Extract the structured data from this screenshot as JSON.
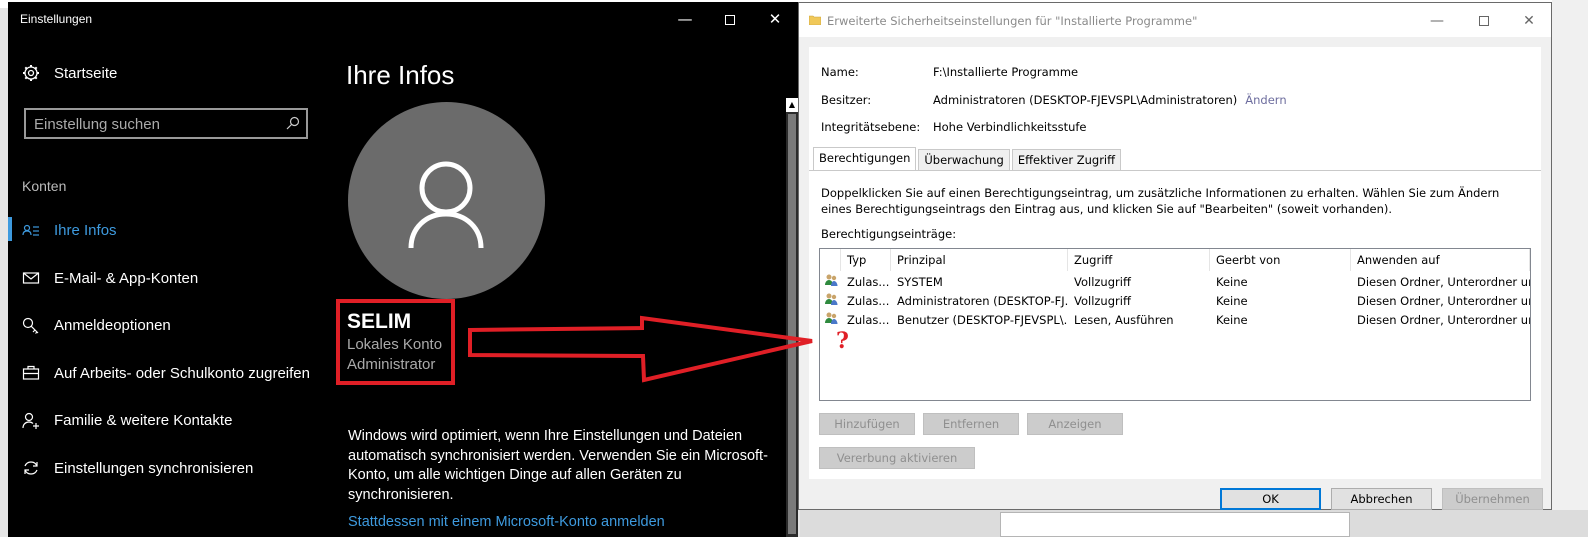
{
  "settings": {
    "window_title": "Einstellungen",
    "controls": {
      "minimize": "—",
      "close": "✕"
    },
    "home_label": "Startseite",
    "search": {
      "placeholder": "Einstellung suchen",
      "value": ""
    },
    "section_label": "Konten",
    "nav": [
      {
        "label": "Ihre Infos",
        "icon": "person-card-icon",
        "active": true
      },
      {
        "label": "E-Mail- & App-Konten",
        "icon": "mail-icon",
        "active": false
      },
      {
        "label": "Anmeldeoptionen",
        "icon": "key-icon",
        "active": false
      },
      {
        "label": "Auf Arbeits- oder Schulkonto zugreifen",
        "icon": "briefcase-icon",
        "active": false
      },
      {
        "label": "Familie & weitere Kontakte",
        "icon": "person-add-icon",
        "active": false
      },
      {
        "label": "Einstellungen synchronisieren",
        "icon": "sync-icon",
        "active": false
      }
    ],
    "heading": "Ihre Infos",
    "user": {
      "name": "SELIM",
      "account_type": "Lokales Konto",
      "role": "Administrator"
    },
    "description": "Windows wird optimiert, wenn Ihre Einstellungen und Dateien automatisch synchronisiert werden. Verwenden Sie ein Microsoft-Konto, um alle wichtigen Dinge auf allen Geräten zu synchronisieren.",
    "link": "Stattdessen mit einem Microsoft-Konto anmelden",
    "accent_color": "#3e9ade"
  },
  "security": {
    "window_title": "Erweiterte Sicherheitseinstellungen für \"Installierte Programme\"",
    "name_label": "Name:",
    "name_value": "F:\\Installierte Programme",
    "owner_label": "Besitzer:",
    "owner_value": "Administratoren (DESKTOP-FJEVSPL\\Administratoren)",
    "owner_change": "Ändern",
    "integrity_label": "Integritätsebene:",
    "integrity_value": "Hohe Verbindlichkeitsstufe",
    "tabs": [
      "Berechtigungen",
      "Überwachung",
      "Effektiver Zugriff"
    ],
    "info_text": "Doppelklicken Sie auf einen Berechtigungseintrag, um zusätzliche Informationen zu erhalten. Wählen Sie zum Ändern eines Berechtigungseintrags den Eintrag aus, und klicken Sie auf \"Bearbeiten\" (soweit vorhanden).",
    "entries_label": "Berechtigungseinträge:",
    "columns": [
      "Typ",
      "Prinzipal",
      "Zugriff",
      "Geerbt von",
      "Anwenden auf"
    ],
    "rows": [
      [
        "Zulas...",
        "SYSTEM",
        "Vollzugriff",
        "Keine",
        "Diesen Ordner, Unterordner un..."
      ],
      [
        "Zulas...",
        "Administratoren (DESKTOP-FJ...",
        "Vollzugriff",
        "Keine",
        "Diesen Ordner, Unterordner un..."
      ],
      [
        "Zulas...",
        "Benutzer (DESKTOP-FJEVSPL\\...",
        "Lesen, Ausführen",
        "Keine",
        "Diesen Ordner, Unterordner un..."
      ]
    ],
    "annotation": "?",
    "buttons": {
      "add": "Hinzufügen",
      "remove": "Entfernen",
      "view": "Anzeigen",
      "inheritance": "Vererbung aktivieren",
      "ok": "OK",
      "cancel": "Abbrechen",
      "apply": "Übernehmen"
    }
  },
  "annotation_color": "#e01f26"
}
